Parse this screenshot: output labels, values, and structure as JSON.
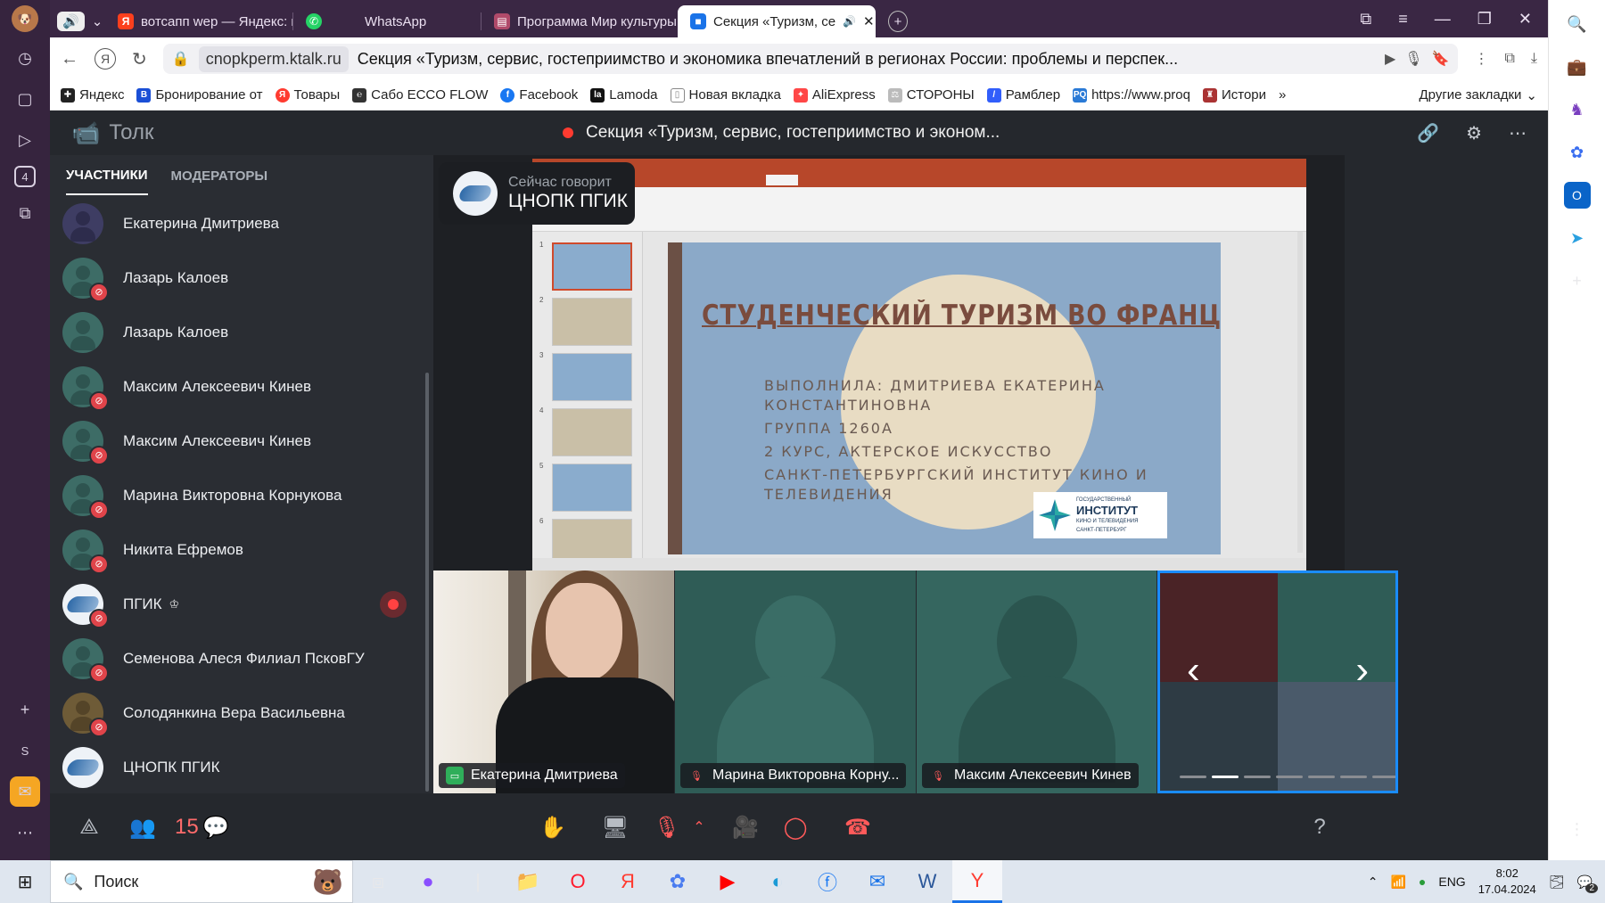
{
  "browser": {
    "tabs": [
      {
        "label": "вотсапп wep — Яндекс: на",
        "icon": "yandex-icon",
        "active": false
      },
      {
        "label": "WhatsApp",
        "icon": "whatsapp-icon",
        "active": false
      },
      {
        "label": "Программа Мир культуры",
        "icon": "document-icon",
        "active": false
      },
      {
        "label": "Секция «Туризм, се",
        "icon": "video-icon",
        "active": true
      }
    ],
    "address": {
      "host": "cnopkperm.ktalk.ru",
      "title": "Секция «Туризм, сервис, гостеприимство и экономика впечатлений в регионах России: проблемы и перспек..."
    },
    "bookmarks": [
      {
        "label": "Яндекс",
        "color": "#222222"
      },
      {
        "label": "Бронирование от",
        "color": "#1a4fd6"
      },
      {
        "label": "Товары",
        "color": "#ff3b30"
      },
      {
        "label": "Сабо ECCO FLOW",
        "color": "#333333"
      },
      {
        "label": "Facebook",
        "color": "#1877f2"
      },
      {
        "label": "Lamoda",
        "color": "#111111"
      },
      {
        "label": "Новая вкладка",
        "color": "#888888"
      },
      {
        "label": "AliExpress",
        "color": "#ff4747"
      },
      {
        "label": "СТОРОНЫ",
        "color": "#999999"
      },
      {
        "label": "Рамблер",
        "color": "#315efb"
      },
      {
        "label": "https://www.proq",
        "color": "#2a7ad6"
      },
      {
        "label": "Истори",
        "color": "#a33"
      }
    ],
    "bookmarks_more": "»",
    "other_bookmarks": "Другие закладки"
  },
  "app": {
    "brand": "Толк",
    "call_title": "Секция «Туризм, сервис, гостеприимство и эконом...",
    "tabs": {
      "participants": "УЧАСТНИКИ",
      "moderators": "МОДЕРАТОРЫ"
    },
    "participants": [
      {
        "name": "Екатерина Дмитриева",
        "avatar": "purple",
        "muted": false
      },
      {
        "name": "Лазарь Калоев",
        "avatar": "teal",
        "muted": true
      },
      {
        "name": "Лазарь Калоев",
        "avatar": "teal",
        "muted": false
      },
      {
        "name": "Максим Алексеевич Кинев",
        "avatar": "teal",
        "muted": true
      },
      {
        "name": "Максим Алексеевич Кинев",
        "avatar": "teal",
        "muted": true
      },
      {
        "name": "Марина Викторовна Корнукова",
        "avatar": "teal",
        "muted": true
      },
      {
        "name": "Никита Ефремов",
        "avatar": "teal",
        "muted": true
      },
      {
        "name": "ПГИК",
        "avatar": "logo",
        "muted": true,
        "crown": true,
        "speaking": true
      },
      {
        "name": "Семенова Алеся Филиал ПсковГУ",
        "avatar": "teal",
        "muted": true
      },
      {
        "name": "Солодянкина Вера Васильевна",
        "avatar": "olive",
        "muted": true
      },
      {
        "name": "ЦНОПК ПГИК",
        "avatar": "logo",
        "muted": false
      }
    ],
    "speaker": {
      "label": "Сейчас говорит",
      "name": "ЦНОПК ПГИК"
    },
    "slide": {
      "title": "СТУДЕНЧЕСКИЙ ТУРИЗМ ВО ФРАНЦИЮ",
      "lines": [
        "ВЫПОЛНИЛА: ДМИТРИЕВА ЕКАТЕРИНА",
        "КОНСТАНТИНОВНА",
        "ГРУППА 1260А",
        "2 КУРС, АКТЕРСКОЕ ИСКУССТВО",
        "САНКТ-ПЕТЕРБУРГСКИЙ ИНСТИТУТ КИНО И",
        "ТЕЛЕВИДЕНИЯ"
      ],
      "logo": {
        "top": "ГОСУДАРСТВЕННЫЙ",
        "main": "ИНСТИТУТ",
        "sub": "КИНО И ТЕЛЕВИДЕНИЯ",
        "city": "САНКТ-ПЕТЕРБУРГ"
      },
      "thumbnail_numbers": [
        "1",
        "2",
        "3",
        "4",
        "5",
        "6"
      ]
    },
    "tiles": [
      {
        "name": "Екатерина Дмитриева",
        "icon": "screen-share-icon"
      },
      {
        "name": "Марина Викторовна Корну...",
        "icon": "mic-off-icon"
      },
      {
        "name": "Максим Алексеевич Кинев",
        "icon": "mic-off-icon"
      }
    ],
    "participant_count": "15",
    "help": "?"
  },
  "taskbar": {
    "search_placeholder": "Поиск",
    "language": "ENG",
    "time": "8:02",
    "date": "17.04.2024",
    "notif_count": "2"
  },
  "colors": {
    "accent_blue": "#1a8cff",
    "mute_red": "#e0444a",
    "slide_title": "#7a4c3e",
    "ppt_red": "#b7472a"
  }
}
